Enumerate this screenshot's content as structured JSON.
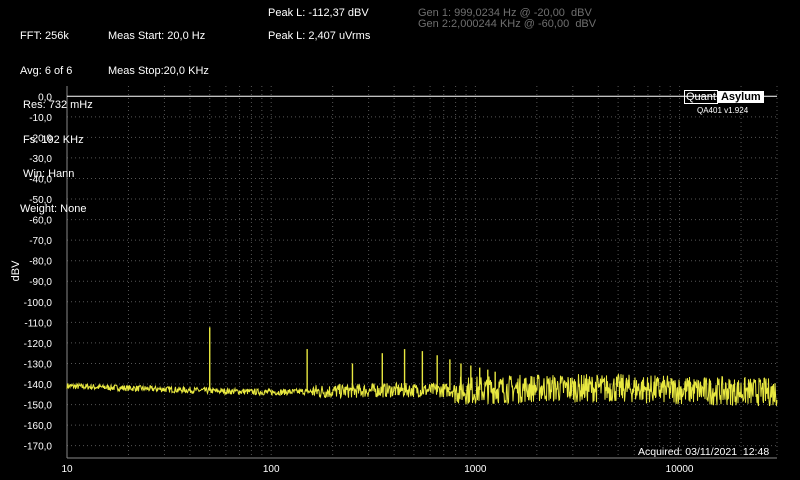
{
  "header": {
    "col1": [
      "FFT: 256k",
      "Avg: 6 of 6",
      " Res: 732 mHz",
      " Fs: 192 KHz",
      " Win: Hann",
      "Weight: None"
    ],
    "col2": [
      "Meas Start: 20,0 Hz",
      "Meas Stop:20,0 KHz"
    ],
    "peak1": "Peak L: -112,37 dBV",
    "peak2": "Peak L: 2,407 uVrms",
    "gen1": "Gen 1: 999,0234 Hz @ -20,00  dBV",
    "gen2": "Gen 2:2,000244 KHz @ -60,00  dBV"
  },
  "logo": {
    "part1": "Quant",
    "part2": "Asylum",
    "version": "QA401 v1.924"
  },
  "acquired": "Acquired: 03/11/2021  12:48",
  "chart_data": {
    "type": "line",
    "ylabel": "dBV",
    "xscale": "log",
    "xlim": [
      10,
      30000
    ],
    "ylim": [
      -176,
      5
    ],
    "xticks": [
      10,
      100,
      1000,
      10000
    ],
    "xtick_labels": [
      "10",
      "100",
      "1000",
      "10000"
    ],
    "yticks": [
      0,
      -10,
      -20,
      -30,
      -40,
      -50,
      -60,
      -70,
      -80,
      -90,
      -100,
      -110,
      -120,
      -130,
      -140,
      -150,
      -160,
      -170
    ],
    "ytick_labels": [
      "0,0",
      "-10,0",
      "-20,0",
      "-30,0",
      "-40,0",
      "-50,0",
      "-60,0",
      "-70,0",
      "-80,0",
      "-90,0",
      "-100,0",
      "-110,0",
      "-120,0",
      "-130,0",
      "-140,0",
      "-150,0",
      "-160,0",
      "-170,0"
    ],
    "grid": true,
    "colors": {
      "trace": "#e8e840",
      "reference": "#ffffff",
      "grid": "#555555"
    },
    "reference_line_dbv": 0,
    "noise_floor": {
      "x": [
        10,
        20,
        40,
        60,
        100,
        200,
        400,
        1000,
        2000,
        5000,
        10000,
        30000
      ],
      "y": [
        -141,
        -142,
        -143,
        -143.5,
        -144,
        -143.5,
        -143,
        -143,
        -142,
        -142,
        -143,
        -144
      ]
    },
    "peaks": {
      "x": [
        50,
        150,
        250,
        350,
        450,
        550,
        650,
        750,
        850,
        950,
        1050,
        1150,
        1250
      ],
      "y": [
        -112.4,
        -123,
        -130,
        -125,
        -123,
        -124,
        -126,
        -128,
        -130,
        -131,
        -132,
        -133,
        -134
      ]
    }
  }
}
